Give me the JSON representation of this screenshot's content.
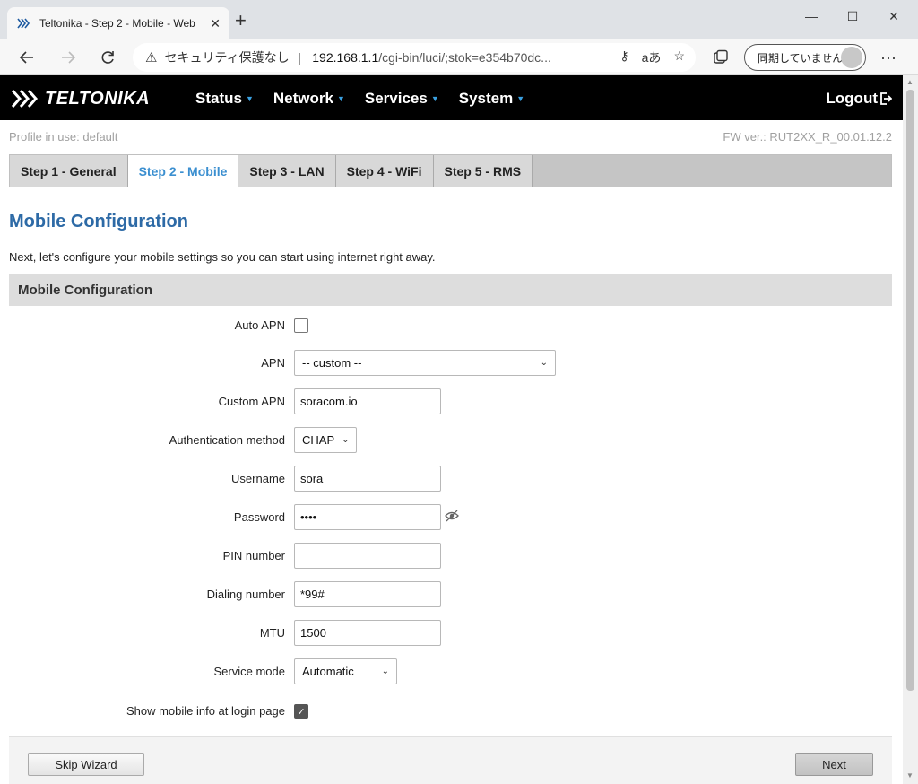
{
  "browser": {
    "tab_title": "Teltonika - Step 2 - Mobile - Web",
    "tab_close": "✕",
    "new_tab": "+",
    "window": {
      "minimize": "—",
      "maximize": "☐",
      "close": "✕"
    },
    "security_label": "セキュリティ保護なし",
    "url_host": "192.168.1.1",
    "url_path": "/cgi-bin/luci/;stok=e354b70dc...",
    "reader_glyph": "aあ",
    "sync_label": "同期していません",
    "more": "···"
  },
  "header": {
    "logo": "TELTONIKA",
    "menu": [
      {
        "label": "Status"
      },
      {
        "label": "Network"
      },
      {
        "label": "Services"
      },
      {
        "label": "System"
      }
    ],
    "logout": "Logout"
  },
  "profile": "Profile in use: default",
  "fw_version": "FW ver.: RUT2XX_R_00.01.12.2",
  "steps": [
    {
      "label": "Step 1 - General",
      "active": false
    },
    {
      "label": "Step 2 - Mobile",
      "active": true
    },
    {
      "label": "Step 3 - LAN",
      "active": false
    },
    {
      "label": "Step 4 - WiFi",
      "active": false
    },
    {
      "label": "Step 5 - RMS",
      "active": false
    }
  ],
  "title": "Mobile Configuration",
  "description": "Next, let's configure your mobile settings so you can start using internet right away.",
  "section_title": "Mobile Configuration",
  "form": {
    "auto_apn": {
      "label": "Auto APN",
      "checked": false
    },
    "apn": {
      "label": "APN",
      "value": "-- custom --"
    },
    "custom_apn": {
      "label": "Custom APN",
      "value": "soracom.io"
    },
    "auth_method": {
      "label": "Authentication method",
      "value": "CHAP"
    },
    "username": {
      "label": "Username",
      "value": "sora"
    },
    "password": {
      "label": "Password",
      "value": "••••"
    },
    "pin": {
      "label": "PIN number",
      "value": ""
    },
    "dialing": {
      "label": "Dialing number",
      "value": "*99#"
    },
    "mtu": {
      "label": "MTU",
      "value": "1500"
    },
    "service_mode": {
      "label": "Service mode",
      "value": "Automatic"
    },
    "show_info": {
      "label": "Show mobile info at login page",
      "checked": true
    }
  },
  "buttons": {
    "skip": "Skip Wizard",
    "next": "Next"
  }
}
